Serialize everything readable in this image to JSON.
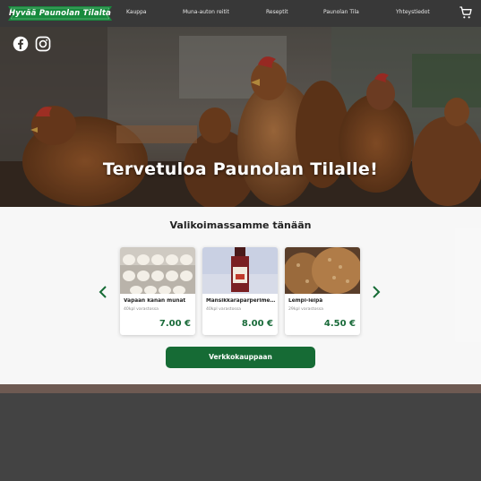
{
  "header": {
    "logo_text": "Hyvää Paunolan Tilalta",
    "nav": [
      {
        "label": "Kauppa"
      },
      {
        "label": "Muna-auton reitit"
      },
      {
        "label": "Reseptit"
      },
      {
        "label": "Paunolan Tila"
      },
      {
        "label": "Yhteystiedot"
      }
    ],
    "cart_icon": "shopping-cart-icon"
  },
  "hero": {
    "title": "Tervetuloa Paunolan Tilalle!",
    "social_icons": [
      "facebook-icon",
      "instagram-icon"
    ]
  },
  "products": {
    "title": "Valikoimassamme tänään",
    "items": [
      {
        "name": "Vapaan kanan munat",
        "stock": "40kpl varastossa",
        "price": "7.00 €"
      },
      {
        "name": "Mansikkaraparperimehu",
        "stock": "40kpl varastossa",
        "price": "8.00 €"
      },
      {
        "name": "Lempi-leipä",
        "stock": "29kpl varastossa",
        "price": "4.50 €"
      }
    ],
    "button_label": "Verkkokauppaan"
  },
  "colors": {
    "brand_green": "#166b35",
    "price_green": "#1a6b3a",
    "header_bg": "#383838"
  }
}
